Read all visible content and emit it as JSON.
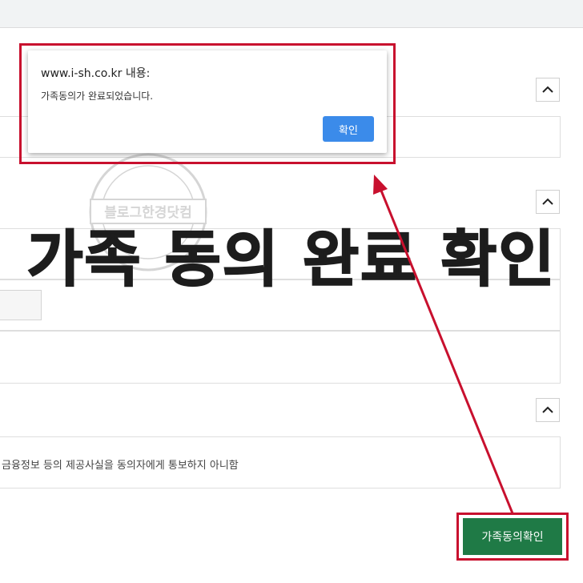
{
  "dialog": {
    "origin": "www.i-sh.co.kr 내용:",
    "message": "가족동의가 완료되었습니다.",
    "ok_label": "확인"
  },
  "overlay": {
    "headline": "가족 동의 완료 확인",
    "watermark": "블로그한경닷컴"
  },
  "sections": {
    "notice_text": "금융정보 등의 제공사실을 동의자에게 통보하지 아니함"
  },
  "footer": {
    "confirm_label": "가족동의확인"
  },
  "colors": {
    "highlight": "#c8102e",
    "dialog_button": "#3b8bea",
    "confirm_button": "#1f7a46"
  }
}
